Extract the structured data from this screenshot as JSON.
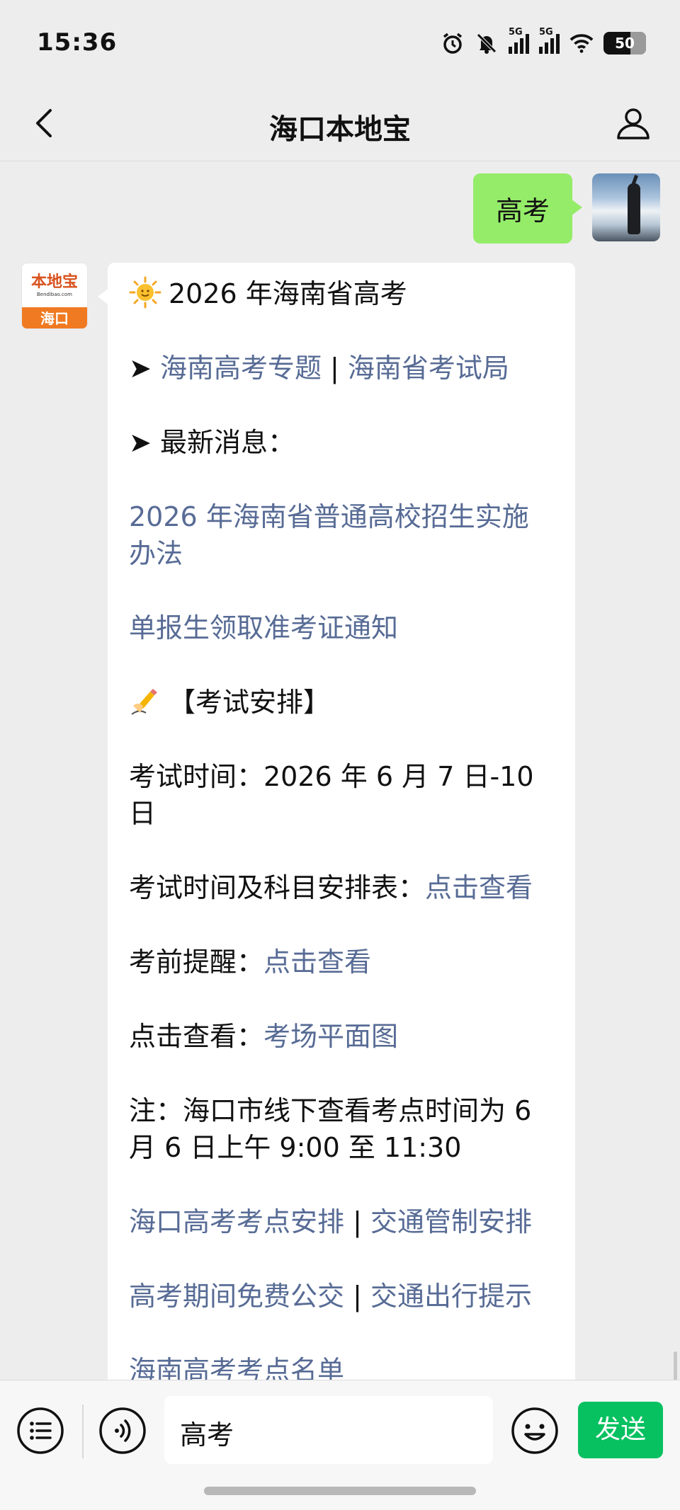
{
  "status_bar": {
    "time": "15:36",
    "signal1_label": "5G",
    "signal2_label": "5G",
    "battery": "50"
  },
  "nav": {
    "title": "海口本地宝"
  },
  "my_message": {
    "text": "高考"
  },
  "bot_avatar": {
    "logo": "本地宝",
    "sub": "Bendibao.com",
    "city": "海口"
  },
  "bot_message": {
    "heading": "2026 年海南省高考",
    "arrow": "➤",
    "link_topic": "海南高考专题",
    "separator": " | ",
    "link_exam_bureau": "海南省考试局",
    "latest_news_label": "最新消息：",
    "news_link_1": "2026 年海南省普通高校招生实施办法",
    "news_link_2": "单报生领取准考证通知",
    "exam_arrangement_label": "【考试安排】",
    "exam_time_text": "考试时间：2026 年 6 月 7 日-10 日",
    "schedule_label": "考试时间及科目安排表：",
    "schedule_link": "点击查看",
    "reminder_label": "考前提醒：",
    "reminder_link": "点击查看",
    "floorplan_label": "点击查看：",
    "floorplan_link": "考场平面图",
    "note_text": "注：海口市线下查看考点时间为 6 月 6 日上午 9:00 至 11:30",
    "link_haikou_sites": "海口高考考点安排",
    "link_traffic_control": "交通管制安排",
    "link_free_bus": "高考期间免费公交",
    "link_travel_tips": "交通出行提示",
    "link_sites_list": "海南高考考点名单"
  },
  "input_bar": {
    "value": "高考",
    "send_label": "发送"
  },
  "colors": {
    "background": "#ededed",
    "my_bubble": "#95ec69",
    "link": "#576b95",
    "send_button": "#07c160",
    "bot_logo": "#d9531e",
    "bot_city_band": "#f07a22"
  }
}
